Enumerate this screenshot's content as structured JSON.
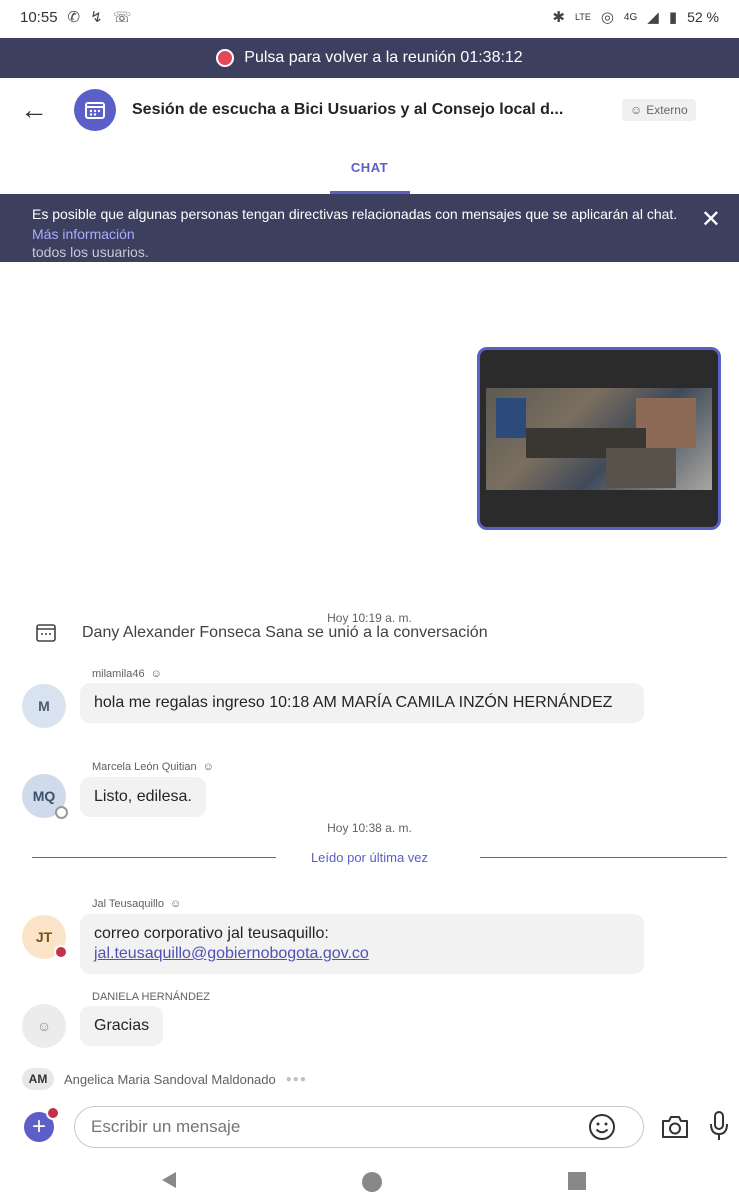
{
  "status_bar": {
    "time": "10:55",
    "signal_text": "4G",
    "volte": "LTE",
    "battery": "52 %"
  },
  "meeting_banner": {
    "text": "Pulsa para volver a la reunión 01:38:12"
  },
  "header": {
    "title": "Sesión de escucha a Bici Usuarios y al Consejo local d...",
    "badge": "Externo"
  },
  "tabs": [
    {
      "label": "CHAT",
      "active": true
    }
  ],
  "policy_banner": {
    "text": "Es posible que algunas personas tengan directivas relacionadas con mensajes que se aplicarán al chat.",
    "link": "Más información",
    "overflow_text": "todos los usuarios."
  },
  "chat": {
    "time_sep_1": "Hoy 10:19 a. m.",
    "system_message": "Dany Alexander Fonseca Sana se unió a la conversación",
    "messages": [
      {
        "sender": "milamila46",
        "initials": "M",
        "text": "hola me regalas ingreso 10:18 AM MARÍA CAMILA INZÓN HERNÁNDEZ"
      },
      {
        "sender": "Marcela León Quitian",
        "initials": "MQ",
        "text": "Listo, edilesa."
      },
      {
        "sender": "Jal Teusaquillo",
        "initials": "JT",
        "text": "correo corporativo jal teusaquillo:",
        "link": "jal.teusaquillo@gobiernobogota.gov.co"
      },
      {
        "sender": "DANIELA HERNÁNDEZ",
        "initials": "",
        "text": "Gracias"
      }
    ],
    "time_sep_2": "Hoy 10:38 a. m.",
    "read_label": "Leído por última vez",
    "typing": {
      "initials": "AM",
      "name": "Angelica Maria Sandoval Maldonado"
    }
  },
  "compose": {
    "placeholder": "Escribir un mensaje"
  },
  "colors": {
    "accent": "#5b5fc7",
    "banner": "#3d3f5e",
    "bubble": "#f2f2f2"
  }
}
